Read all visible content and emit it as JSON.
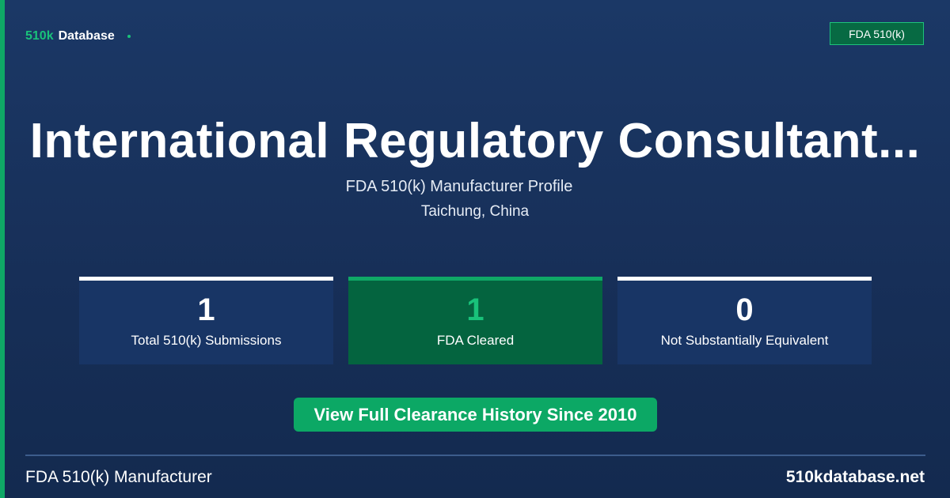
{
  "brand": {
    "accent_text": "510k",
    "name_text": "Database"
  },
  "badge": {
    "label": "FDA 510(k)"
  },
  "profile": {
    "title": "International Regulatory Consultant...",
    "subtitle": "FDA 510(k) Manufacturer Profile",
    "location": "Taichung, China"
  },
  "stats": [
    {
      "value": "1",
      "label": "Total 510(k) Submissions"
    },
    {
      "value": "1",
      "label": "FDA Cleared"
    },
    {
      "value": "0",
      "label": "Not Substantially Equivalent"
    }
  ],
  "cta": {
    "label": "View Full Clearance History Since 2010"
  },
  "footer": {
    "left_text": "FDA 510(k) Manufacturer",
    "right_text": "510kdatabase.net"
  },
  "colors": {
    "background": "#1b3866",
    "accent_green": "#0fa866",
    "highlight_green": "#19c27a",
    "cleared_card": "#04643f",
    "card_background": "#183565"
  }
}
